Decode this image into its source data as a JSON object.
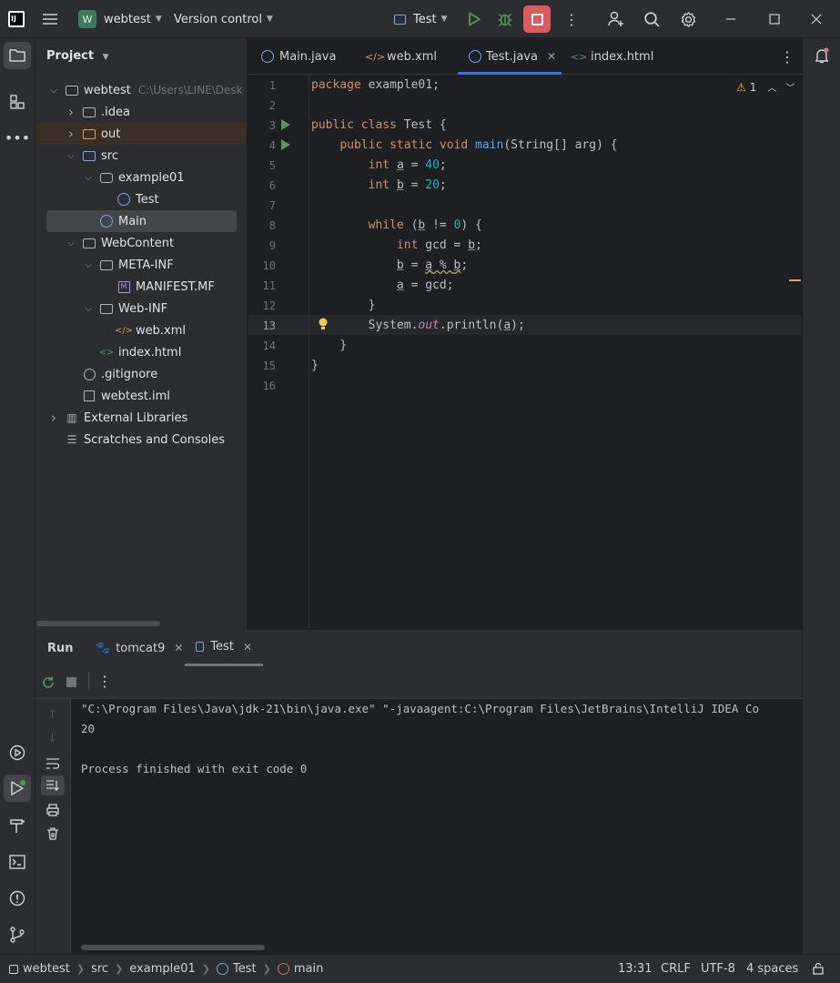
{
  "titlebar": {
    "logo": "IJ",
    "project_initial": "W",
    "project_name": "webtest",
    "vcs_label": "Version control",
    "run_config": "Test"
  },
  "project_panel": {
    "title": "Project",
    "tree": [
      {
        "label": "webtest",
        "hint": "C:\\Users\\LINE\\Desk",
        "indent": 0,
        "chevron": "down",
        "icon": "module"
      },
      {
        "label": ".idea",
        "indent": 1,
        "chevron": "right",
        "icon": "folder"
      },
      {
        "label": "out",
        "indent": 1,
        "chevron": "right",
        "icon": "folder-orange"
      },
      {
        "label": "src",
        "indent": 1,
        "chevron": "down",
        "icon": "folder-blue"
      },
      {
        "label": "example01",
        "indent": 2,
        "chevron": "down",
        "icon": "package"
      },
      {
        "label": "Test",
        "indent": 3,
        "chevron": "",
        "icon": "class"
      },
      {
        "label": "Main",
        "indent": 2,
        "chevron": "",
        "icon": "class"
      },
      {
        "label": "WebContent",
        "indent": 1,
        "chevron": "down",
        "icon": "folder"
      },
      {
        "label": "META-INF",
        "indent": 2,
        "chevron": "down",
        "icon": "folder"
      },
      {
        "label": "MANIFEST.MF",
        "indent": 3,
        "chevron": "",
        "icon": "manifest"
      },
      {
        "label": "Web-INF",
        "indent": 2,
        "chevron": "down",
        "icon": "folder"
      },
      {
        "label": "web.xml",
        "indent": 3,
        "chevron": "",
        "icon": "xml"
      },
      {
        "label": "index.html",
        "indent": 2,
        "chevron": "",
        "icon": "html"
      },
      {
        "label": ".gitignore",
        "indent": 1,
        "chevron": "",
        "icon": "ignore"
      },
      {
        "label": "webtest.iml",
        "indent": 1,
        "chevron": "",
        "icon": "iml"
      },
      {
        "label": "External Libraries",
        "indent": 0,
        "chevron": "right",
        "icon": "library"
      },
      {
        "label": "Scratches and Consoles",
        "indent": 0,
        "chevron": "",
        "icon": "scratch"
      }
    ]
  },
  "editor": {
    "tabs": [
      {
        "label": "Main.java",
        "icon": "class"
      },
      {
        "label": "web.xml",
        "icon": "xml"
      },
      {
        "label": "Test.java",
        "icon": "class",
        "active": true
      },
      {
        "label": "index.html",
        "icon": "html"
      }
    ],
    "warning_count": "1",
    "line_numbers": [
      "1",
      "2",
      "3",
      "4",
      "5",
      "6",
      "7",
      "8",
      "9",
      "10",
      "11",
      "12",
      "13",
      "14",
      "15",
      "16"
    ],
    "current_line": "13"
  },
  "run_panel": {
    "title": "Run",
    "tabs": [
      {
        "label": "tomcat9"
      },
      {
        "label": "Test"
      }
    ],
    "console": [
      "\"C:\\Program Files\\Java\\jdk-21\\bin\\java.exe\" \"-javaagent:C:\\Program Files\\JetBrains\\IntelliJ IDEA Co",
      "20",
      "",
      "Process finished with exit code 0"
    ]
  },
  "statusbar": {
    "breadcrumbs": [
      "webtest",
      "src",
      "example01",
      "Test",
      "main"
    ],
    "position": "13:31",
    "line_ending": "CRLF",
    "encoding": "UTF-8",
    "indent": "4 spaces"
  }
}
